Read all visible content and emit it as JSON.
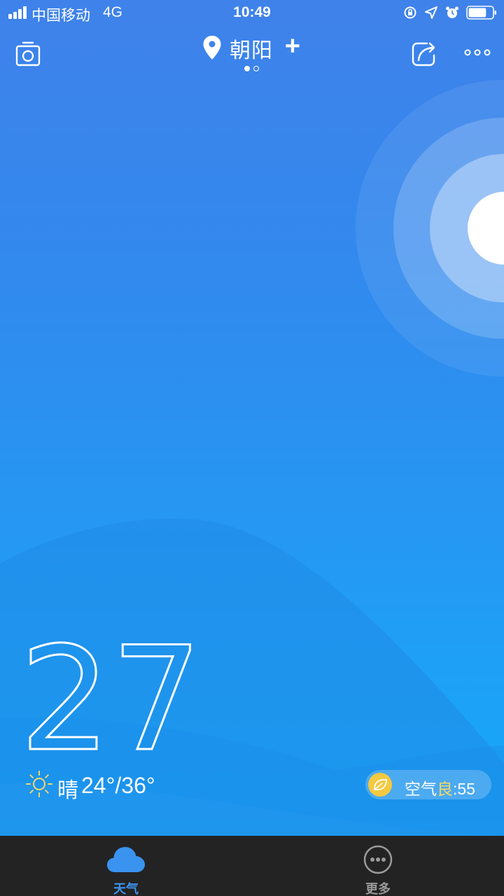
{
  "status_bar": {
    "carrier": "中国移动",
    "network": "4G",
    "time": "10:49",
    "icons": [
      "rotation-lock-icon",
      "location-arrow-icon",
      "alarm-icon",
      "battery-icon"
    ],
    "battery_level": 0.75
  },
  "header": {
    "city": "朝阳",
    "add_symbol": "+",
    "page_count": 2,
    "active_page": 0,
    "icons": [
      "camera-icon",
      "location-pin-icon",
      "share-icon",
      "more-dots-icon"
    ]
  },
  "current": {
    "temperature": "27°",
    "condition": "晴",
    "range": "24°/36°",
    "condition_icon": "sun-icon"
  },
  "aqi": {
    "label": "空气",
    "level": "良",
    "value": ":55",
    "icon": "leaf-icon"
  },
  "tabs": [
    {
      "label": "天气",
      "icon": "cloud-icon",
      "active": true
    },
    {
      "label": "更多",
      "icon": "more-circle-icon",
      "active": false
    }
  ],
  "colors": {
    "background_top": "#3f82ea",
    "background_bottom": "#12aefb",
    "accent": "#3a93ef",
    "aqi_icon": "#f3c941",
    "tab_bar": "#232323"
  }
}
